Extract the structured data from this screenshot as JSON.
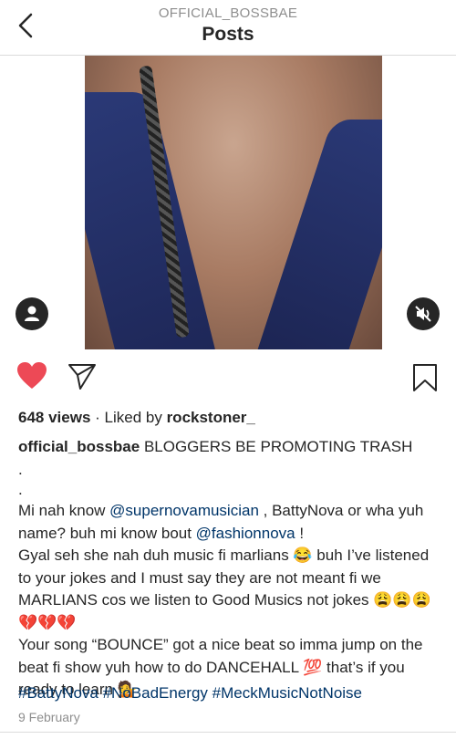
{
  "header": {
    "username": "OFFICIAL_BOSSBAE",
    "title": "Posts"
  },
  "icons": {
    "back": "chevron-left-icon",
    "user_tag": "user-tag-icon",
    "mute": "speaker-muted-icon",
    "like": "heart-filled-icon",
    "share": "send-icon",
    "save": "bookmark-icon"
  },
  "colors": {
    "like": "#ed4956",
    "link": "#003569",
    "muted_text": "#8e8e8e"
  },
  "post": {
    "views": "648 views",
    "liked_by_prefix": " · Liked by ",
    "liked_by_user": "rockstoner_",
    "caption_user": "official_bossbae",
    "caption_text": " BLOGGERS BE PROMOTING TRASH",
    "dots": ".\n.",
    "line1_a": "Mi nah know ",
    "mention1": "@supernovamusician",
    "line1_b": " , BattyNova or wha yuh name? buh mi know bout ",
    "mention2": "@fashionnova",
    "line1_c": " !\nGyal seh she nah duh music fi marlians 😂 buh I’ve listened to your jokes and I must say they are not meant fi we MARLIANS cos we listen to Good Musics not jokes 😩😩😩💔💔💔\nYour song “BOUNCE” got a nice beat so imma jump on the beat fi show yuh how to do DANCEHALL 💯 that’s if you ready to learn 💁",
    "hashtags": "#BattyNova #NoBadEnergy #MeckMusicNotNoise",
    "date": "9 February"
  }
}
